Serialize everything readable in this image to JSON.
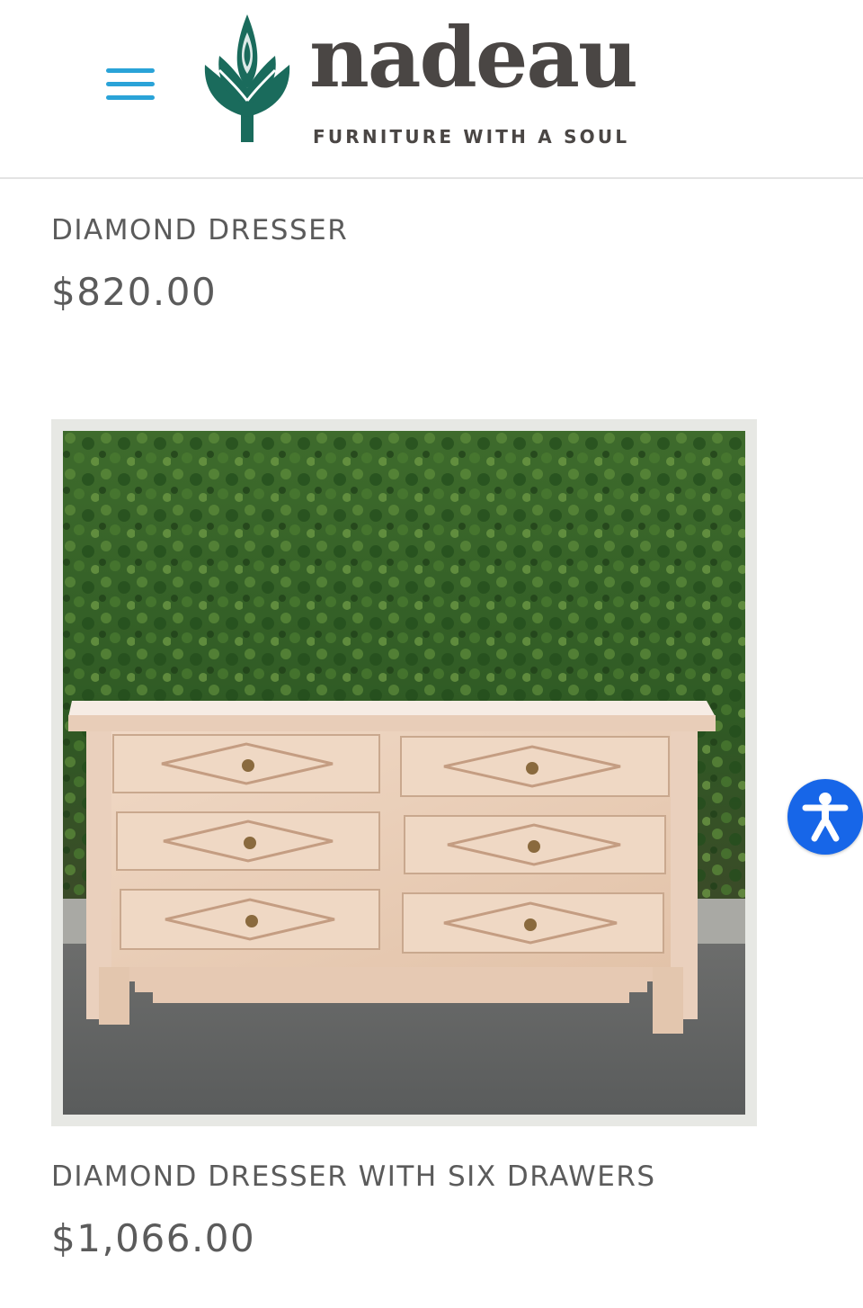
{
  "header": {
    "brand": "nadeau",
    "tagline": "FURNITURE WITH A SOUL",
    "menu_icon": "hamburger-menu-icon",
    "logo_icon": "artichoke-logo-icon"
  },
  "products": [
    {
      "title": "DIAMOND DRESSER",
      "price": "$820.00"
    },
    {
      "title": "DIAMOND DRESSER WITH SIX DRAWERS",
      "price": "$1,066.00",
      "image_subject": "whitewashed six-drawer dresser with diamond-carved fronts"
    }
  ],
  "accessibility": {
    "icon": "accessibility-person-icon"
  },
  "colors": {
    "accent_blue": "#2aa3d8",
    "logo_teal": "#1a6b5c",
    "text_gray": "#5b5b5b",
    "brand_dark": "#4a4644",
    "a11y_blue": "#1766e8"
  }
}
